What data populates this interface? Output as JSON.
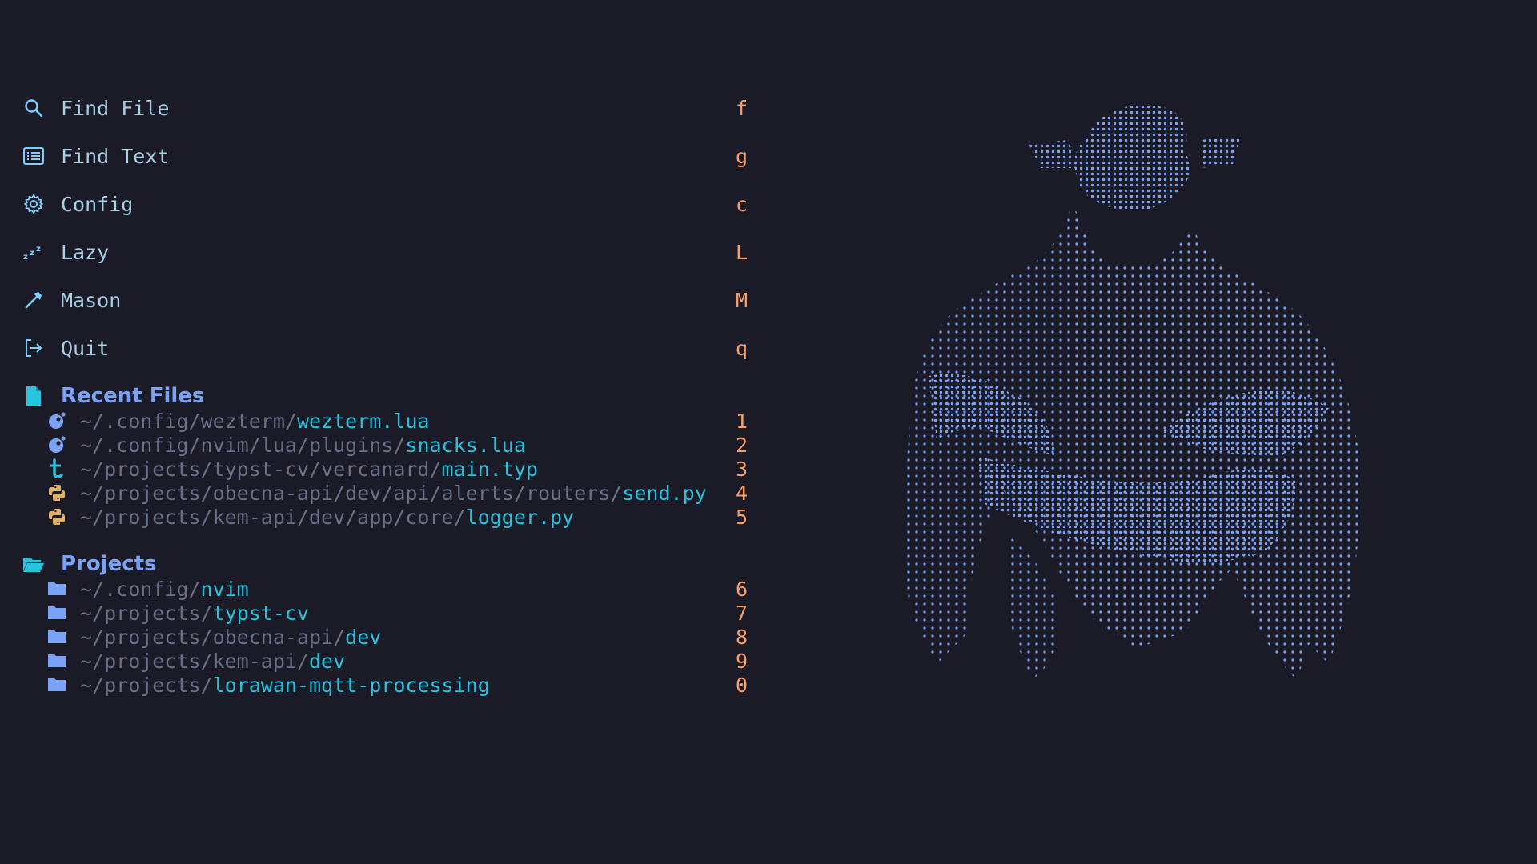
{
  "colors": {
    "background": "#1a1b26",
    "accent": "#7dcfff",
    "key": "#ff9e64",
    "section": "#7aa2f7",
    "path": "#6b7089",
    "filename": "#2ac3de",
    "art": "#7aa2f7"
  },
  "menu": [
    {
      "icon": "search-icon",
      "label": "Find File",
      "key": "f"
    },
    {
      "icon": "list-icon",
      "label": "Find Text",
      "key": "g"
    },
    {
      "icon": "gear-icon",
      "label": "Config",
      "key": "c"
    },
    {
      "icon": "sleep-icon",
      "label": "Lazy",
      "key": "L"
    },
    {
      "icon": "hammer-icon",
      "label": "Mason",
      "key": "M"
    },
    {
      "icon": "exit-icon",
      "label": "Quit",
      "key": "q"
    }
  ],
  "recent": {
    "title": "Recent Files",
    "icon": "file-icon",
    "items": [
      {
        "icon": "lua-icon",
        "path": "~/.config/wezterm/",
        "name": "wezterm.lua",
        "key": "1"
      },
      {
        "icon": "lua-icon",
        "path": "~/.config/nvim/lua/plugins/",
        "name": "snacks.lua",
        "key": "2"
      },
      {
        "icon": "typst-icon",
        "path": "~/projects/typst-cv/vercanard/",
        "name": "main.typ",
        "key": "3"
      },
      {
        "icon": "python-icon",
        "path": "~/projects/obecna-api/dev/api/alerts/routers/",
        "name": "send.py",
        "key": "4"
      },
      {
        "icon": "python-icon",
        "path": "~/projects/kem-api/dev/app/core/",
        "name": "logger.py",
        "key": "5"
      }
    ]
  },
  "projects": {
    "title": "Projects",
    "icon": "folder-open-icon",
    "items": [
      {
        "icon": "folder-icon",
        "path": "~/.config/",
        "name": "nvim",
        "key": "6"
      },
      {
        "icon": "folder-icon",
        "path": "~/projects/",
        "name": "typst-cv",
        "key": "7"
      },
      {
        "icon": "folder-icon",
        "path": "~/projects/obecna-api/",
        "name": "dev",
        "key": "8"
      },
      {
        "icon": "folder-icon",
        "path": "~/projects/kem-api/",
        "name": "dev",
        "key": "9"
      },
      {
        "icon": "folder-icon",
        "path": "~/projects/",
        "name": "lorawan-mqtt-processing",
        "key": "0"
      }
    ]
  }
}
